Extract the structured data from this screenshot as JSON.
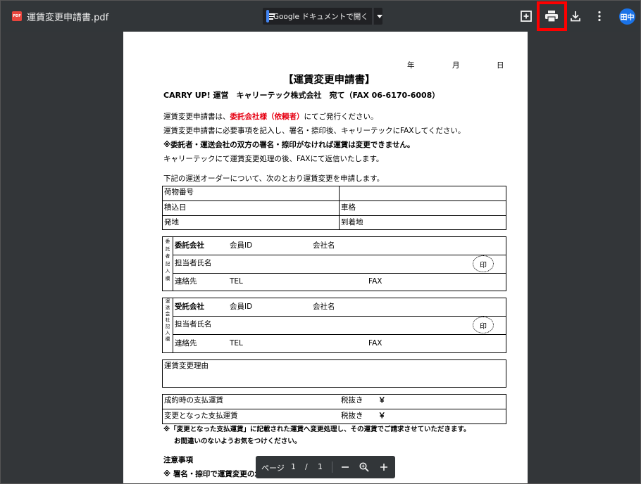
{
  "toolbar": {
    "file_icon_text": "PDF",
    "file_name": "運賃変更申請書.pdf",
    "open_with_label": "Google ドキュメントで開く",
    "avatar_text": "田中",
    "icons": [
      "add-comment-icon",
      "print-icon",
      "download-icon",
      "more-vert-icon"
    ],
    "highlight_color": "#ff0000"
  },
  "doc": {
    "date_year": "年",
    "date_month": "月",
    "date_day": "日",
    "title": "【運賃変更申請書】",
    "addressee": "CARRY UP! 運営　キャリーテック株式会社　宛て（FAX 06-6170-6008）",
    "intro1_a": "運賃変更申請書は、",
    "intro1_red": "委託会社様（依頼者）",
    "intro1_b": "にてご発行ください。",
    "intro2": "運賃変更申請書に必要事項を記入し、署名・捺印後、キャリーテックにFAXしてください。",
    "intro3": "※委託者・運送会社の双方の署名・捺印がなければ運賃は変更できません。",
    "intro4": "キャリーテックにて運賃変更処理の後、FAXにて返信いたします。",
    "lead": "下記の運送オーダーについて、次のとおり運賃変更を申請します。",
    "cargo_no": "荷物番号",
    "load_date": "積込日",
    "vehicle": "車格",
    "origin": "発地",
    "destination": "到着地",
    "consignor_side": "委託者記入欄",
    "consignor_company": "委託会社",
    "carrier_side": "運送会社記入欄",
    "carrier_company": "受託会社",
    "member_id": "会員ID",
    "company_name": "会社名",
    "person": "担当者氏名",
    "seal": "印",
    "contact": "連絡先",
    "tel": "TEL",
    "fax": "FAX",
    "reason": "運賃変更理由",
    "contract_fare": "成約時の支払運賃",
    "changed_fare": "変更となった支払運賃",
    "tax_excl": "税抜き",
    "yen": "￥",
    "note1": "※「変更となった支払運賃」に記載された運賃へ変更処理し、その運賃でご請求させていただきます。",
    "note2": "お間違いのないようお気をつけください。",
    "caution_title": "注意事項",
    "caution1": "※ 署名・捺印で運賃変更の承諾といたします。"
  },
  "zoom": {
    "page_label": "ページ",
    "current_page": "1",
    "separator": "/",
    "total_pages": "1"
  }
}
